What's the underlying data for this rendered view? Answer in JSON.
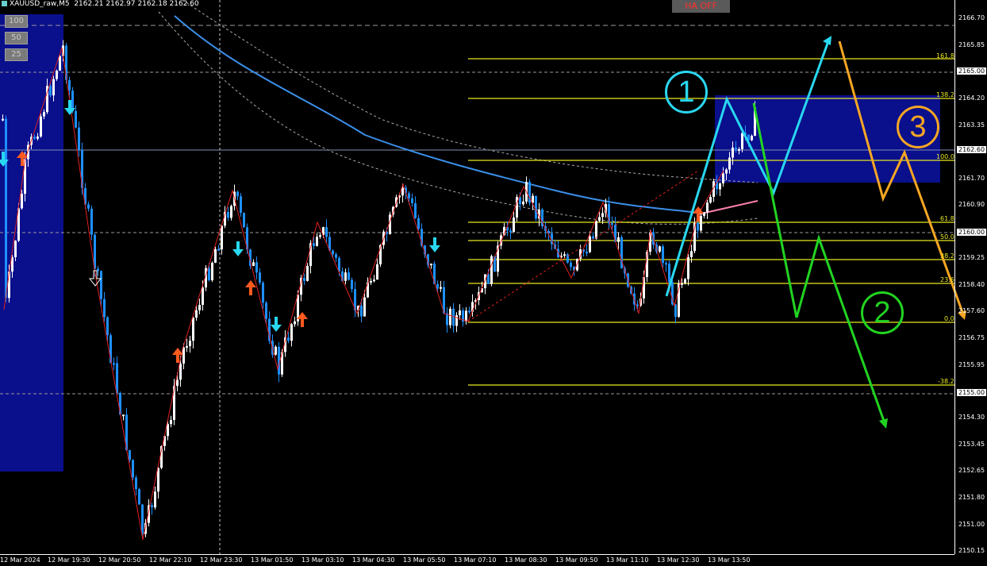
{
  "header": {
    "symbol": "XAUUSD_raw,M5",
    "ohlc": "2162.21 2162.97 2162.18 2162.60"
  },
  "zoom": [
    "100",
    "50",
    "25"
  ],
  "ha_toggle": "HA OFF",
  "price_axis": [
    "2166.70",
    "2165.85",
    "2165.00",
    "2164.20",
    "2163.35",
    "2162.60",
    "2161.70",
    "2160.90",
    "2160.00",
    "2159.25",
    "2158.40",
    "2157.60",
    "2156.75",
    "2155.95",
    "2155.00",
    "2154.30",
    "2153.45",
    "2152.65",
    "2151.80",
    "2151.00",
    "2150.15"
  ],
  "highlighted_prices": [
    "2165.00",
    "2162.60",
    "2160.00",
    "2155.00"
  ],
  "time_axis": [
    "12 Mar 2024",
    "12 Mar 19:30",
    "12 Mar 20:50",
    "12 Mar 22:10",
    "12 Mar 23:30",
    "13 Mar 01:50",
    "13 Mar 03:10",
    "13 Mar 04:30",
    "13 Mar 05:50",
    "13 Mar 07:10",
    "13 Mar 08:30",
    "13 Mar 09:50",
    "13 Mar 11:10",
    "13 Mar 12:30",
    "13 Mar 13:50"
  ],
  "fibo_levels": [
    "161.8",
    "138.2",
    "100.0",
    "61.8",
    "50.0",
    "38.2",
    "23.6",
    "0.0",
    "-38.2"
  ],
  "scenarios": [
    "1",
    "2",
    "3"
  ],
  "colors": {
    "background": "#000000",
    "candle_up": "#ffffff",
    "candle_down": "#1e90ff",
    "fibo": "#e8e820",
    "ma": "#3b8fe8",
    "zone": "#0a0f8c",
    "scenario1": "#29d7f0",
    "scenario2": "#22d422",
    "scenario3": "#f5a623",
    "arrow_up": "#ff5a1f",
    "arrow_down": "#29d7f0"
  }
}
